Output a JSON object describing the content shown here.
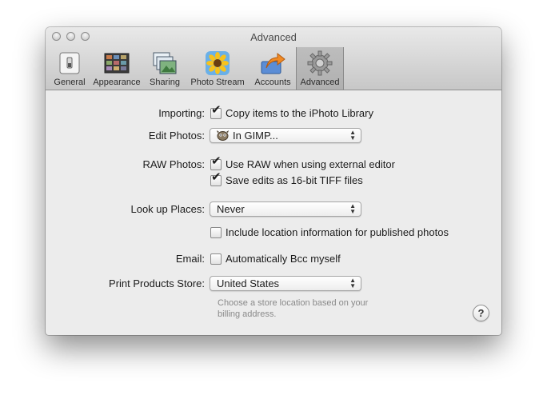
{
  "window": {
    "title": "Advanced"
  },
  "toolbar": {
    "tabs": [
      {
        "label": "General",
        "icon": "general-icon"
      },
      {
        "label": "Appearance",
        "icon": "appearance-icon"
      },
      {
        "label": "Sharing",
        "icon": "sharing-icon"
      },
      {
        "label": "Photo Stream",
        "icon": "photo-stream-icon"
      },
      {
        "label": "Accounts",
        "icon": "accounts-icon"
      },
      {
        "label": "Advanced",
        "icon": "gear-icon",
        "selected": true
      }
    ]
  },
  "importing": {
    "label": "Importing:",
    "copy_items": {
      "label": "Copy items to the iPhoto Library",
      "checked": true
    }
  },
  "edit_photos": {
    "label": "Edit Photos:",
    "value": "In GIMP..."
  },
  "raw_photos": {
    "label": "RAW Photos:",
    "use_raw": {
      "label": "Use RAW when using external editor",
      "checked": true
    },
    "save_16bit": {
      "label": "Save edits as 16-bit TIFF files",
      "checked": true
    }
  },
  "look_up_places": {
    "label": "Look up Places:",
    "value": "Never",
    "include_location": {
      "label": "Include location information for published photos",
      "checked": false
    }
  },
  "email": {
    "label": "Email:",
    "auto_bcc": {
      "label": "Automatically Bcc myself",
      "checked": false
    }
  },
  "print_store": {
    "label": "Print Products Store:",
    "value": "United States",
    "hint_line1": "Choose a store location based on your",
    "hint_line2": "billing address."
  },
  "help": {
    "label": "?"
  },
  "checkmark": "✔"
}
